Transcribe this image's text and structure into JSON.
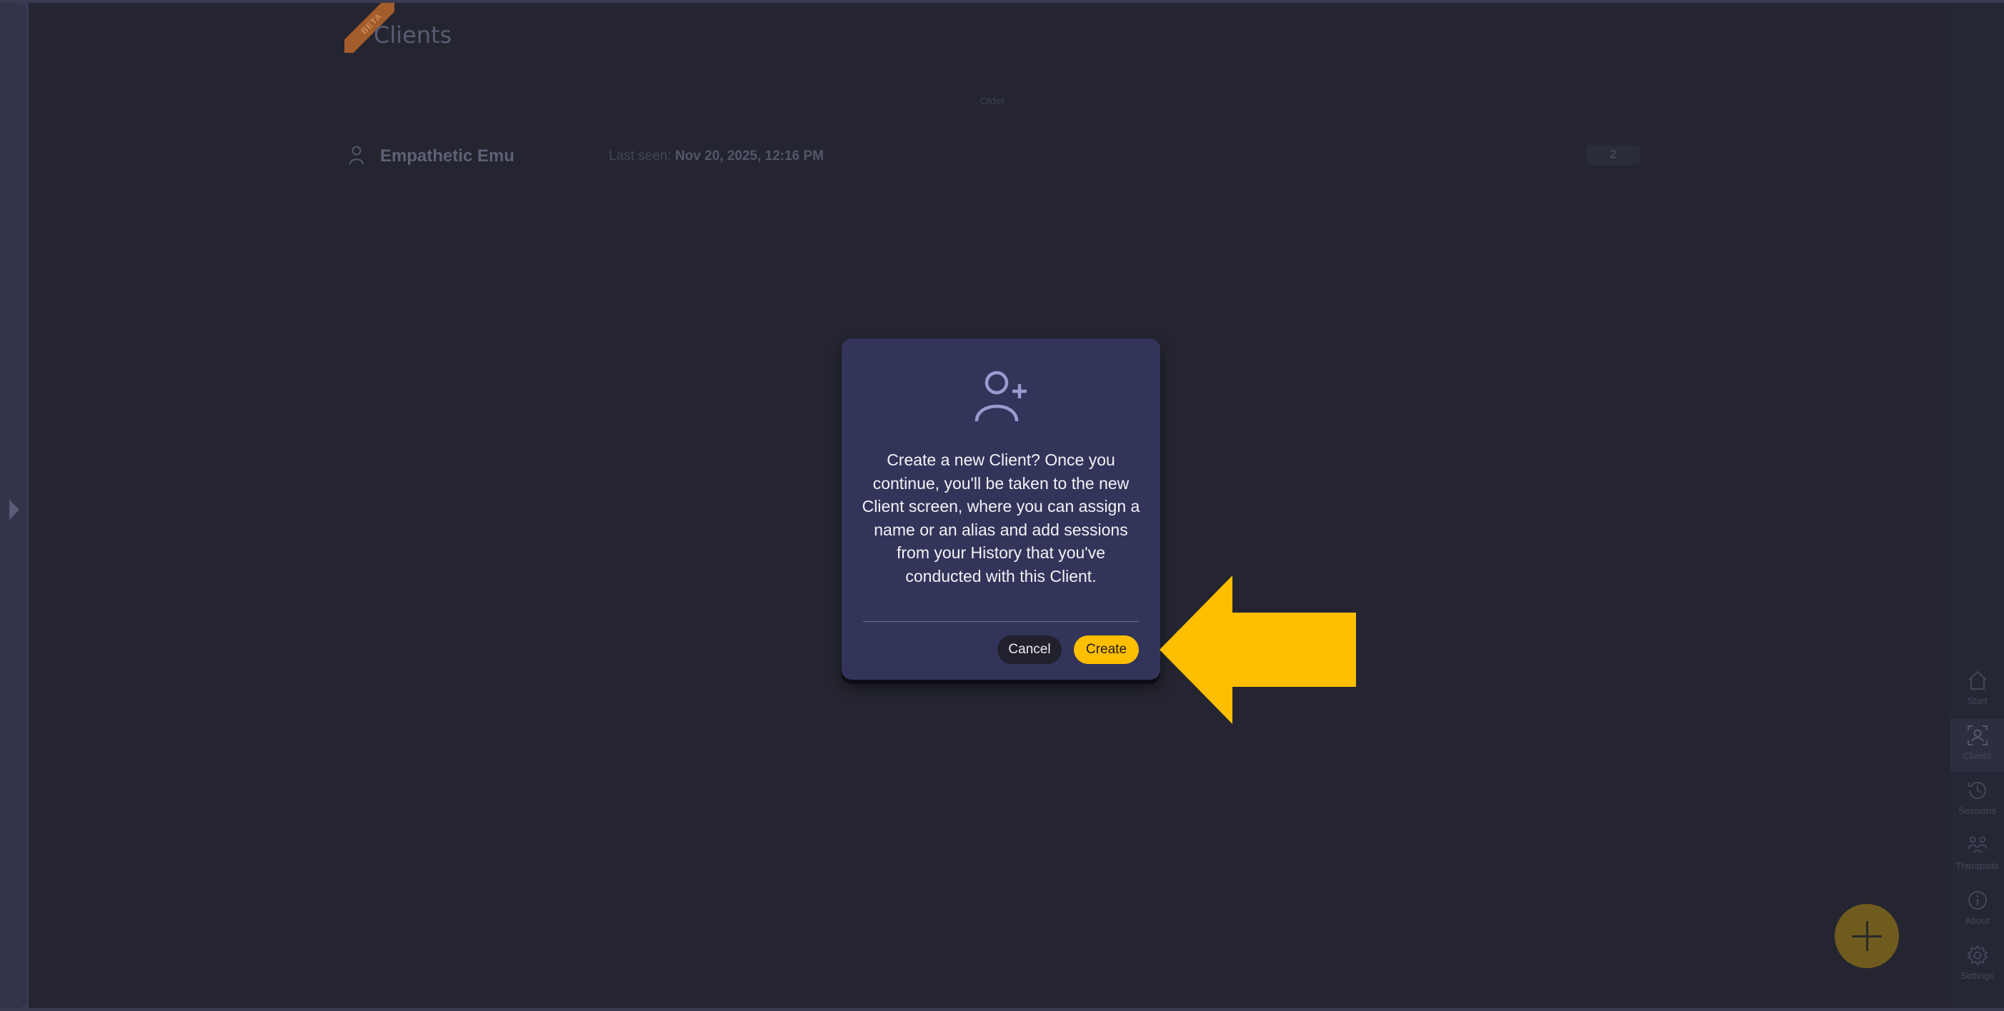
{
  "header": {
    "beta_badge": "BETA",
    "title": "Clients"
  },
  "list": {
    "section_label": "Older",
    "clients": [
      {
        "name": "Empathetic Emu",
        "last_seen_label": "Last seen:",
        "last_seen_value": "Nov 20, 2025, 12:16 PM",
        "count": "2"
      }
    ]
  },
  "nav": {
    "items": [
      {
        "label": "Start",
        "icon": "home-icon"
      },
      {
        "label": "Clients",
        "icon": "clients-icon",
        "active": true
      },
      {
        "label": "Sessions",
        "icon": "history-icon"
      },
      {
        "label": "Therapists",
        "icon": "therapists-icon"
      },
      {
        "label": "About",
        "icon": "info-icon"
      },
      {
        "label": "Settings",
        "icon": "gear-icon"
      }
    ]
  },
  "fab": {
    "icon": "plus-icon"
  },
  "modal": {
    "icon": "add-user-icon",
    "message": "Create a new Client? Once you continue, you'll be taken to the new Client screen, where you can assign a name or an alias and add sessions from your History that you've conducted with this Client.",
    "cancel_label": "Cancel",
    "create_label": "Create"
  },
  "annotation": {
    "icon": "yellow-arrow-pointer",
    "color": "#ffbe00"
  }
}
